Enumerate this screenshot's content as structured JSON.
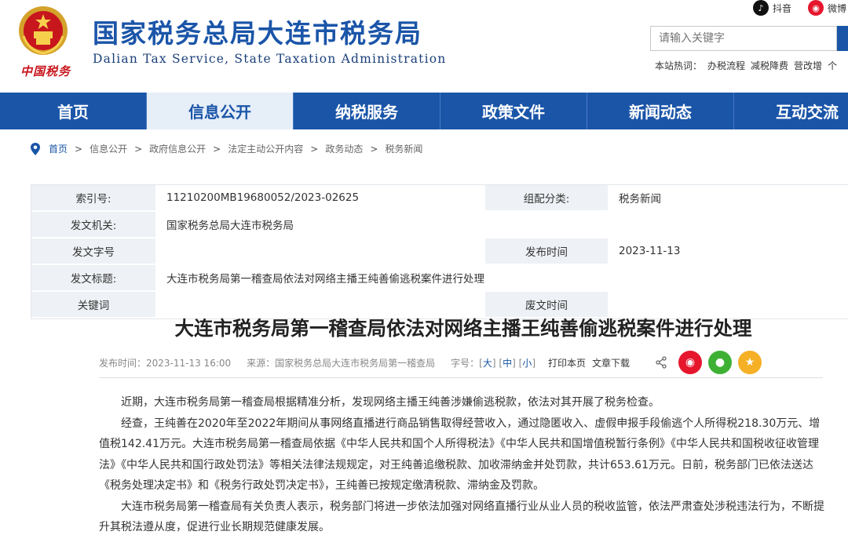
{
  "header": {
    "title": "国家税务总局大连市税务局",
    "subtitle": "Dalian Tax Service, State Taxation Administration",
    "logo_text": "中国税务",
    "social": [
      {
        "icon": "douyin-icon",
        "label": "抖音"
      },
      {
        "icon": "weibo-icon",
        "label": "微博"
      }
    ],
    "search_placeholder": "请输入关键字",
    "hot_words_label": "本站热词：",
    "hot_words": [
      "办税流程",
      "减税降费",
      "营改增",
      "个"
    ]
  },
  "nav": {
    "items": [
      "首页",
      "信息公开",
      "纳税服务",
      "政策文件",
      "新闻动态",
      "互动交流"
    ],
    "active_index": 1
  },
  "breadcrumb": {
    "items": [
      "首页",
      "信息公开",
      "政府信息公开",
      "法定主动公开内容",
      "政务动态",
      "税务新闻"
    ],
    "separator": ">"
  },
  "meta": {
    "index_label": "索引号:",
    "index_value": "11210200MB19680052/2023-02625",
    "category_label": "组配分类:",
    "category_value": "税务新闻",
    "issuer_label": "发文机关:",
    "issuer_value": "国家税务总局大连市税务局",
    "doc_no_label": "发文字号",
    "doc_no_value": "",
    "pub_time_label": "发布时间",
    "pub_time_value": "2023-11-13",
    "doc_title_label": "发文标题:",
    "doc_title_value": "大连市税务局第一稽查局依法对网络主播王纯善偷逃税案件进行处理",
    "keywords_label": "关键词",
    "keywords_value": "",
    "abolish_label": "废文时间",
    "abolish_value": ""
  },
  "article": {
    "title": "大连市税务局第一稽查局依法对网络主播王纯善偷逃税案件进行处理",
    "pub_time": "发布时间：2023-11-13 16:00",
    "source": "来源：国家税务总局大连市税务局第一稽查局",
    "font_size_label": "字号：",
    "font_large": "大",
    "font_medium": "中",
    "font_small": "小",
    "print": "打印本页",
    "download": "文章下载",
    "paragraphs": [
      "近期，大连市税务局第一稽查局根据精准分析，发现网络主播王纯善涉嫌偷逃税款，依法对其开展了税务检查。",
      "经查，王纯善在2020年至2022年期间从事网络直播进行商品销售取得经营收入，通过隐匿收入、虚假申报手段偷逃个人所得税218.30万元、增值税142.41万元。大连市税务局第一稽查局依据《中华人民共和国个人所得税法》《中华人民共和国增值税暂行条例》《中华人民共和国税收征收管理法》《中华人民共和国行政处罚法》等相关法律法规规定，对王纯善追缴税款、加收滞纳金并处罚款，共计653.61万元。日前，税务部门已依法送达《税务处理决定书》和《税务行政处罚决定书》，王纯善已按规定缴清税款、滞纳金及罚款。",
      "大连市税务局第一稽查局有关负责人表示，税务部门将进一步依法加强对网络直播行业从业人员的税收监管，依法严肃查处涉税违法行为，不断提升其税法遵从度，促进行业长期规范健康发展。"
    ]
  },
  "colors": {
    "brand_blue": "#1a55a8",
    "logo_red": "#c8161d",
    "weibo_red": "#e6162d",
    "wechat_green": "#3eb135",
    "favorite_yellow": "#f5b025"
  }
}
